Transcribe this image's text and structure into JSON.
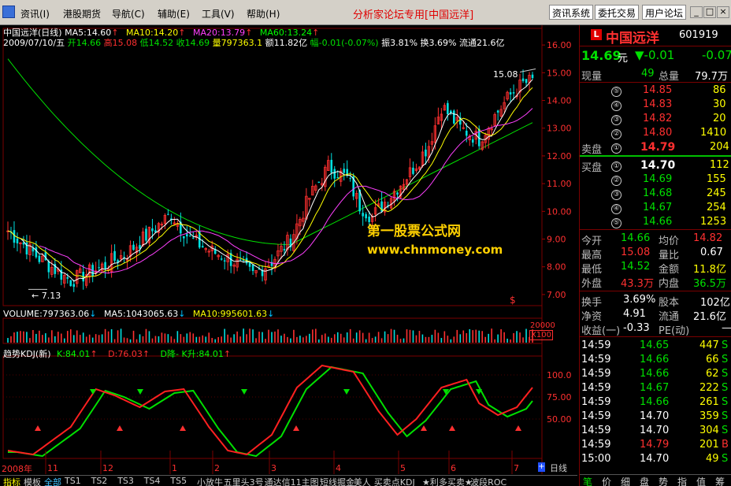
{
  "menu": {
    "items": [
      "资讯(I)",
      "港股期货",
      "导航(C)",
      "辅助(E)",
      "工具(V)",
      "帮助(H)"
    ],
    "slogan": "分析家论坛专用",
    "slogan_tag": "[中国远洋]",
    "sys_buttons": [
      "资讯系统",
      "委托交易",
      "用户论坛"
    ],
    "win_buttons": [
      "_",
      "□",
      "×"
    ]
  },
  "info": {
    "line1_title": "中国远洋(日线)",
    "ma5": "MA5:14.60",
    "ma10": "MA10:14.20",
    "ma20": "MA20:13.79",
    "ma60": "MA60:13.24",
    "date": "2009/07/10/五",
    "open": "开14.66",
    "high": "高15.08",
    "low": "低14.52",
    "close": "收14.69",
    "volume": "量797363.1",
    "amount": "额11.82亿",
    "change": "幅-0.01(-0.07%)",
    "amplitude": "振3.81%",
    "turnover": "换3.69%",
    "float": "流通21.6亿",
    "volume_line": "VOLUME:797363.06",
    "vol_ma5": "MA5:1043065.63",
    "vol_ma10": "MA10:995601.63",
    "kdj_title": "趋势KDJ(新)",
    "kdj_k": "K:84.01",
    "kdj_d": "D:76.03",
    "kdj_label": "D降- K升:84.01",
    "watermark1": "第一股票公式网",
    "watermark2": "www.chnmoney.com",
    "label_high": "15.08",
    "label_low": "7.13",
    "x100": "X100",
    "vol_axis": "20000",
    "day_label": "日线",
    "year_label": "2008年"
  },
  "chart_data": {
    "type": "candlestick",
    "y_ticks": [
      7.0,
      8.0,
      9.0,
      10.0,
      11.0,
      12.0,
      13.0,
      14.0,
      15.0,
      16.0
    ],
    "y_tick_labels": [
      "7.00",
      "8.00",
      "9.00",
      "10.00",
      "11.00",
      "12.00",
      "13.00",
      "14.00",
      "15.00",
      "16.00"
    ],
    "ylim": [
      6.6,
      16.6
    ],
    "kdj_ticks": [
      "100.0",
      "75.00",
      "50.00"
    ],
    "x_month_labels": [
      "11",
      "12",
      "1",
      "2",
      "3",
      "4",
      "5",
      "6",
      "7"
    ],
    "high_marker": 15.08,
    "low_marker": 7.13
  },
  "stock": {
    "name": "中国远洋",
    "code": "601919",
    "price": "14.69",
    "price_unit": "元",
    "change": "▼-0.01",
    "change_pct": "-0.07",
    "now_vol_label": "现量",
    "now_vol": "49",
    "total_vol_label": "总量",
    "total_vol": "79.7万",
    "sell": [
      {
        "lvl": "⑤",
        "price": "14.85",
        "vol": "86"
      },
      {
        "lvl": "④",
        "price": "14.83",
        "vol": "30"
      },
      {
        "lvl": "③",
        "price": "14.82",
        "vol": "20"
      },
      {
        "lvl": "②",
        "price": "14.80",
        "vol": "1410"
      }
    ],
    "sell1_label": "卖盘",
    "sell1_lvl": "①",
    "sell1_price": "14.79",
    "sell1_vol": "204",
    "buy1_label": "买盘",
    "buy1_lvl": "①",
    "buy1_price": "14.70",
    "buy1_vol": "112",
    "buy": [
      {
        "lvl": "②",
        "price": "14.69",
        "vol": "155"
      },
      {
        "lvl": "③",
        "price": "14.68",
        "vol": "245"
      },
      {
        "lvl": "④",
        "price": "14.67",
        "vol": "254"
      },
      {
        "lvl": "⑤",
        "price": "14.66",
        "vol": "1253"
      }
    ],
    "stats": [
      {
        "l1": "今开",
        "v1": "14.66",
        "c1": "green",
        "l2": "均价",
        "v2": "14.82",
        "c2": "red"
      },
      {
        "l1": "最高",
        "v1": "15.08",
        "c1": "red",
        "l2": "量比",
        "v2": "0.67",
        "c2": "white"
      },
      {
        "l1": "最低",
        "v1": "14.52",
        "c1": "green",
        "l2": "金额",
        "v2": "11.8亿",
        "c2": "yellow"
      },
      {
        "l1": "外盘",
        "v1": "43.3万",
        "c1": "red",
        "l2": "内盘",
        "v2": "36.5万",
        "c2": "green"
      }
    ],
    "stats2": [
      {
        "l1": "换手",
        "v1": "3.69%",
        "c1": "white",
        "l2": "股本",
        "v2": "102亿",
        "c2": "white"
      },
      {
        "l1": "净资",
        "v1": "4.91",
        "c1": "white",
        "l2": "流通",
        "v2": "21.6亿",
        "c2": "white"
      },
      {
        "l1": "收益(一)",
        "v1": "-0.33",
        "c1": "white",
        "l2": "PE(动)",
        "v2": "—",
        "c2": "white"
      }
    ],
    "ticks": [
      {
        "t": "14:59",
        "p": "14.65",
        "pc": "green",
        "v": "447",
        "s": "S",
        "sc": "green"
      },
      {
        "t": "14:59",
        "p": "14.66",
        "pc": "green",
        "v": "66",
        "s": "S",
        "sc": "green"
      },
      {
        "t": "14:59",
        "p": "14.66",
        "pc": "green",
        "v": "62",
        "s": "S",
        "sc": "green"
      },
      {
        "t": "14:59",
        "p": "14.67",
        "pc": "green",
        "v": "222",
        "s": "S",
        "sc": "green"
      },
      {
        "t": "14:59",
        "p": "14.66",
        "pc": "green",
        "v": "261",
        "s": "S",
        "sc": "green"
      },
      {
        "t": "14:59",
        "p": "14.70",
        "pc": "white",
        "v": "359",
        "s": "S",
        "sc": "green"
      },
      {
        "t": "14:59",
        "p": "14.70",
        "pc": "white",
        "v": "304",
        "s": "S",
        "sc": "green"
      },
      {
        "t": "14:59",
        "p": "14.79",
        "pc": "red",
        "v": "201",
        "s": "B",
        "sc": "red"
      },
      {
        "t": "15:00",
        "p": "14.70",
        "pc": "white",
        "v": "49",
        "s": "S",
        "sc": "green"
      }
    ],
    "right_tabs": [
      "笔",
      "价",
      "细",
      "盘",
      "势",
      "指",
      "值",
      "筹"
    ]
  },
  "tabs": [
    "指标",
    "模板",
    "全部",
    "TS1",
    "TS2",
    "TS3",
    "TS4",
    "TS5",
    "小放牛",
    "五里头3号",
    "通达信11主图",
    "短线掘金",
    "美人",
    "买卖点KDJ",
    "★利多买卖★",
    "波段ROC"
  ]
}
